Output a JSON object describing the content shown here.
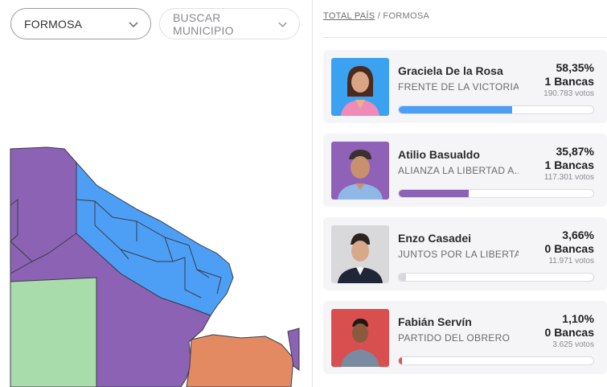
{
  "filters": {
    "province": "FORMOSA",
    "municipio_placeholder": "BUSCAR MUNICIPIO"
  },
  "breadcrumb": {
    "root": "TOTAL PAÍS",
    "separator": " / ",
    "current": "FORMOSA"
  },
  "map": {
    "colors": {
      "frente_de_la_victoria": "#4d9ff5",
      "alianza_la_libertad_avanza": "#8c62b4",
      "other_green": "#a8dcaa",
      "other_orange": "#e38a63",
      "boundary": "#3a3a4a"
    }
  },
  "candidates": [
    {
      "name": "Graciela De la Rosa",
      "party": "FRENTE DE LA VICTORIA",
      "percent": "58,35%",
      "bancas": "1 Bancas",
      "votos": "190.783 votos",
      "share": 0.5835,
      "color": "#4d9ff5",
      "photo_bg": "#3aa2f0"
    },
    {
      "name": "Atilio Basualdo",
      "party": "ALIANZA LA LIBERTAD A...",
      "percent": "35,87%",
      "bancas": "1 Bancas",
      "votos": "117.301 votos",
      "share": 0.3587,
      "color": "#8c62b4",
      "photo_bg": "#8f62b8"
    },
    {
      "name": "Enzo Casadei",
      "party": "JUNTOS POR LA LIBERTA...",
      "percent": "3,66%",
      "bancas": "0 Bancas",
      "votos": "11.971 votos",
      "share": 0.0366,
      "color": "#d8d8dc",
      "photo_bg": "#d9d9db"
    },
    {
      "name": "Fabián Servín",
      "party": "PARTIDO DEL OBRERO",
      "percent": "1,10%",
      "bancas": "0 Bancas",
      "votos": "3.625 votos",
      "share": 0.011,
      "color": "#e05050",
      "photo_bg": "#d94e4e"
    }
  ]
}
